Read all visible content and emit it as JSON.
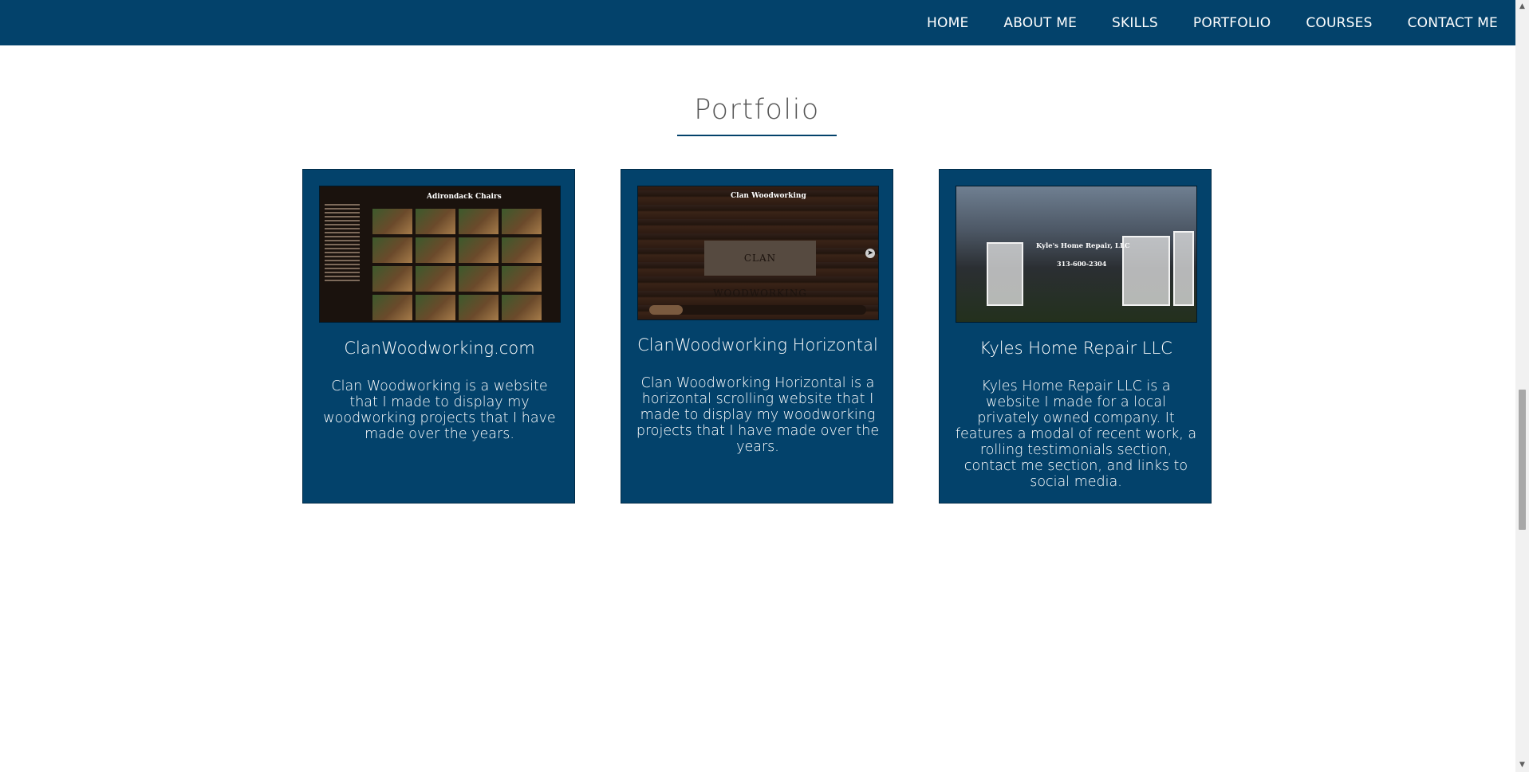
{
  "nav": {
    "items": [
      "HOME",
      "ABOUT ME",
      "SKILLS",
      "PORTFOLIO",
      "COURSES",
      "CONTACT ME"
    ]
  },
  "portfolio": {
    "title": "Portfolio",
    "cards": [
      {
        "title": "ClanWoodworking.com",
        "description": "Clan Woodworking is a website that I made to display my woodworking projects that I have made over the years.",
        "thumbnail_heading": "Adirondack Chairs"
      },
      {
        "title": "ClanWoodworking Horizontal",
        "description": "Clan Woodworking Horizontal is a horizontal scrolling website that I made to display my woodworking projects that I have made over the years.",
        "thumbnail_heading": "Clan Woodworking",
        "thumbnail_sign": "CLAN WOODWORKING"
      },
      {
        "title": "Kyles Home Repair LLC",
        "description": "Kyles Home Repair LLC is a website I made for a local privately owned company. It features a modal of recent work, a rolling testimonials section, contact me section, and links to social media.",
        "thumbnail_heading": "Kyle's Home Repair, LLC",
        "thumbnail_phone": "313-600-2304"
      }
    ]
  },
  "colors": {
    "brand": "#03426b",
    "title_text": "#555555",
    "background": "#ffffff"
  },
  "icons": {
    "scroll_up": "scroll-up-arrow-icon",
    "scroll_down": "scroll-down-arrow-icon",
    "carousel_next": "carousel-next-icon"
  }
}
